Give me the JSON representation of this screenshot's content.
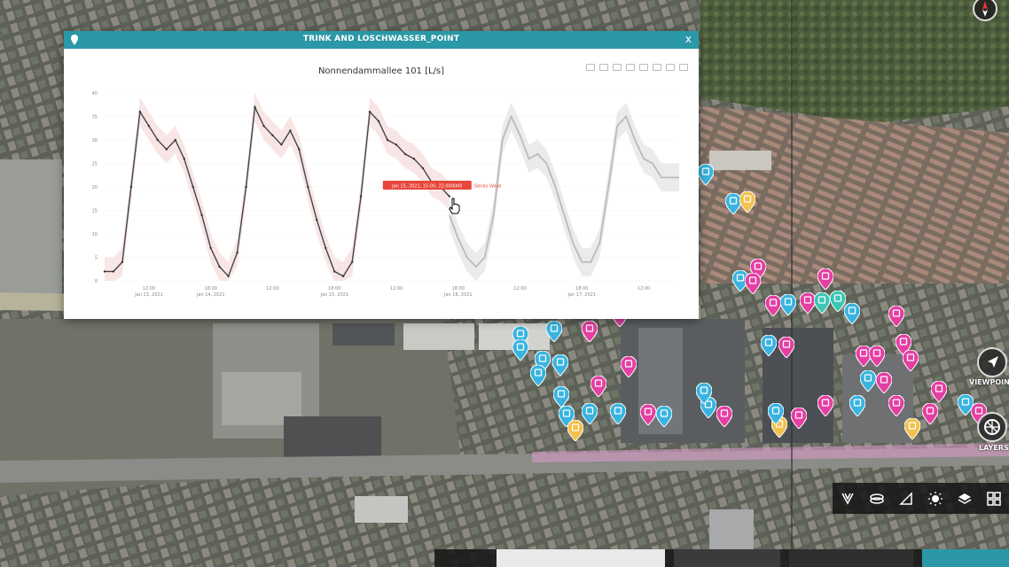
{
  "panel": {
    "title": "TRINK AND LOSCHWASSER_POINT",
    "close_label": "x"
  },
  "chart_data": {
    "type": "line",
    "title": "Nonnendammallee 101 [L/s]",
    "xlabel": "",
    "ylabel": "",
    "ylim": [
      0,
      40
    ],
    "y_ticks": [
      "0",
      "5",
      "10",
      "15",
      "20",
      "25",
      "30",
      "35",
      "40"
    ],
    "x_ticks": [
      [
        "12:00",
        "Jan 13, 2021"
      ],
      [
        "18:00",
        "Jan 14, 2021"
      ],
      [
        "12:00",
        ""
      ],
      [
        "18:00",
        "Jan 15, 2021"
      ],
      [
        "12:00",
        ""
      ],
      [
        "18:00",
        "Jan 16, 2021"
      ],
      [
        "12:00",
        ""
      ],
      [
        "18:00",
        "Jan 17, 2021"
      ],
      [
        "12:00",
        ""
      ]
    ],
    "series": [
      {
        "color": "#444444",
        "x": [
          0,
          2,
          4,
          6,
          8,
          10,
          12,
          14,
          16,
          18,
          20,
          22,
          24,
          26,
          28,
          30,
          32,
          34,
          36,
          38,
          40,
          42,
          44,
          46,
          48,
          50,
          52,
          54
        ],
        "values": [
          2,
          2,
          4,
          20,
          36,
          33,
          30,
          28,
          30,
          26,
          20,
          14,
          7,
          3,
          1,
          6,
          20,
          37,
          33,
          31,
          29,
          32,
          28,
          20,
          13,
          7,
          2,
          1
        ]
      },
      {
        "color": "#444444",
        "x": [
          54,
          56,
          58,
          60,
          62,
          64,
          66,
          68,
          70,
          72,
          74,
          76,
          78
        ],
        "values": [
          1,
          4,
          18,
          36,
          34,
          30,
          29,
          27,
          26,
          24,
          21,
          20,
          18
        ]
      },
      {
        "color": "#bbbbbb",
        "x": [
          78,
          80,
          82,
          84,
          86,
          88,
          90,
          92,
          94,
          96,
          98,
          100,
          102,
          104,
          106,
          108,
          110,
          112,
          114,
          116,
          118,
          120,
          122,
          124,
          126,
          128,
          130
        ],
        "values": [
          14,
          9,
          5,
          3,
          5,
          14,
          30,
          35,
          31,
          26,
          27,
          25,
          20,
          14,
          8,
          4,
          4,
          8,
          20,
          33,
          35,
          30,
          26,
          25,
          22,
          22,
          22
        ]
      }
    ],
    "tooltip": "Jan 15, 2021, 15:00, 22.000000",
    "tooltip_series": "Series Value"
  },
  "map": {
    "viewpoint_label": "VIEWPOINT",
    "layers_label": "LAYERS"
  },
  "colors": {
    "header": "#2a98a6",
    "pin_cyan": "#39b4e0",
    "pin_magenta": "#e43fa3",
    "pin_yellow": "#f2c14e",
    "pin_teal": "#3cc6b4",
    "tooltip": "#e8463a"
  },
  "toolbar_icons": [
    "pin-filter-icon",
    "stack-icon",
    "measure-icon",
    "sun-icon",
    "layers-icon",
    "grid-icon"
  ]
}
